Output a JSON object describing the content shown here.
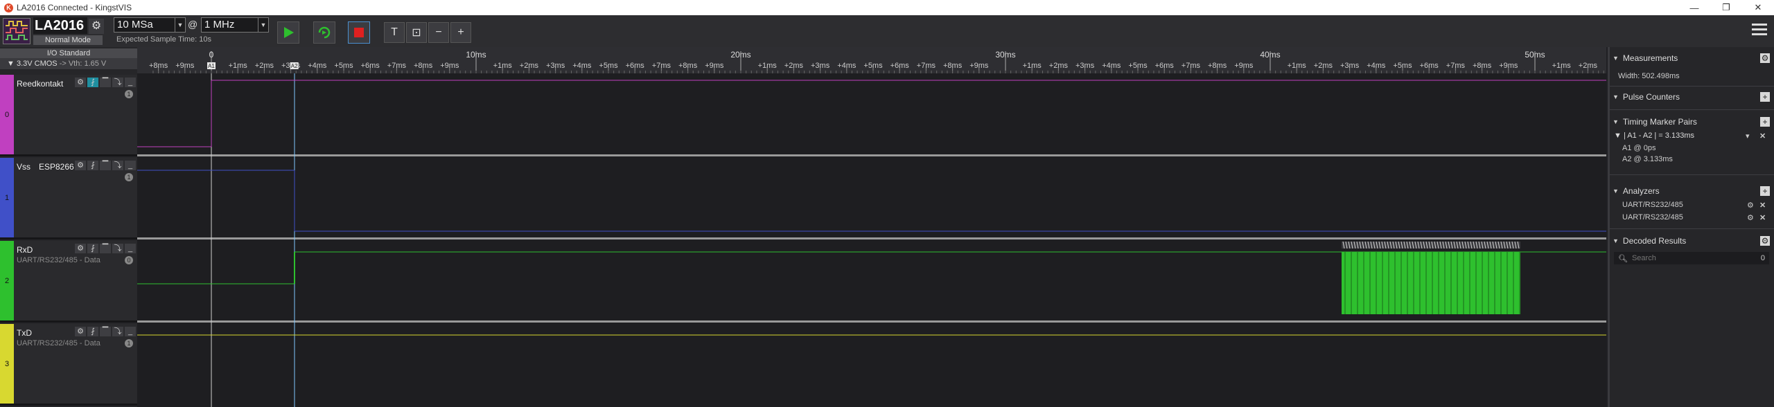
{
  "window": {
    "title": "LA2016 Connected - KingstVIS",
    "minimize_glyph": "—",
    "maximize_glyph": "❐",
    "close_glyph": "✕"
  },
  "toolbar": {
    "device_name": "LA2016",
    "device_mode": "Normal Mode",
    "sample_depth": "10 MSa",
    "at_sign": "@",
    "sample_rate": "1 MHz",
    "expected_sample_time": "Expected Sample Time: 10s",
    "start_icon": "play-icon",
    "single_icon": "repeat-icon",
    "stop_icon": "stop-icon",
    "text_tool": "T",
    "zoom_fit_tool": "⊡",
    "zoom_out_tool": "−",
    "zoom_in_tool": "+"
  },
  "io": {
    "title": "I/O Standard",
    "standard": "3.3V CMOS",
    "vth": "-> Vth: 1.65 V"
  },
  "channels": [
    {
      "num": "0",
      "name": "Reedkontakt",
      "extra": "",
      "sub": "",
      "badge": "1",
      "color": "#c040c0"
    },
    {
      "num": "1",
      "name": "Vss",
      "extra": "ESP8266",
      "sub": "",
      "badge": "1",
      "color": "#4050c8"
    },
    {
      "num": "2",
      "name": "RxD",
      "extra": "",
      "sub": "UART/RS232/485 - Data",
      "badge": "0",
      "color": "#2ec02e"
    },
    {
      "num": "3",
      "name": "TxD",
      "extra": "",
      "sub": "UART/RS232/485 - Data",
      "badge": "1",
      "color": "#d8d830"
    }
  ],
  "channel_tools": [
    "⚙",
    "⨏",
    "▔",
    "⤵",
    "_"
  ],
  "ruler": {
    "major_labels": [
      "0",
      "10ms",
      "20ms",
      "30ms",
      "40ms",
      "50ms"
    ],
    "minor_labels_before_zero": [
      "+8ms",
      "+9ms"
    ],
    "minor_labels_between": [
      "+1ms",
      "+2ms",
      "+3ms",
      "+4ms",
      "+5ms",
      "+6ms",
      "+7ms",
      "+8ms",
      "+9ms"
    ],
    "minor_labels_after_last": [
      "+1ms",
      "+2ms"
    ],
    "marker_a1": "A1",
    "marker_a2": "A2"
  },
  "right_panel": {
    "measurements": {
      "title": "Measurements",
      "width_label": "Width:",
      "width_value": "502.498ms"
    },
    "pulse_counters": {
      "title": "Pulse Counters"
    },
    "timing_markers": {
      "title": "Timing Marker Pairs",
      "pair_label": "| A1 - A2 | = 3.133ms",
      "a1": "A1 @ 0ps",
      "a2": "A2 @ 3.133ms"
    },
    "analyzers": {
      "title": "Analyzers",
      "items": [
        "UART/RS232/485",
        "UART/RS232/485"
      ]
    },
    "decoded_results": {
      "title": "Decoded Results",
      "search_placeholder": "Search",
      "count": "0"
    }
  }
}
